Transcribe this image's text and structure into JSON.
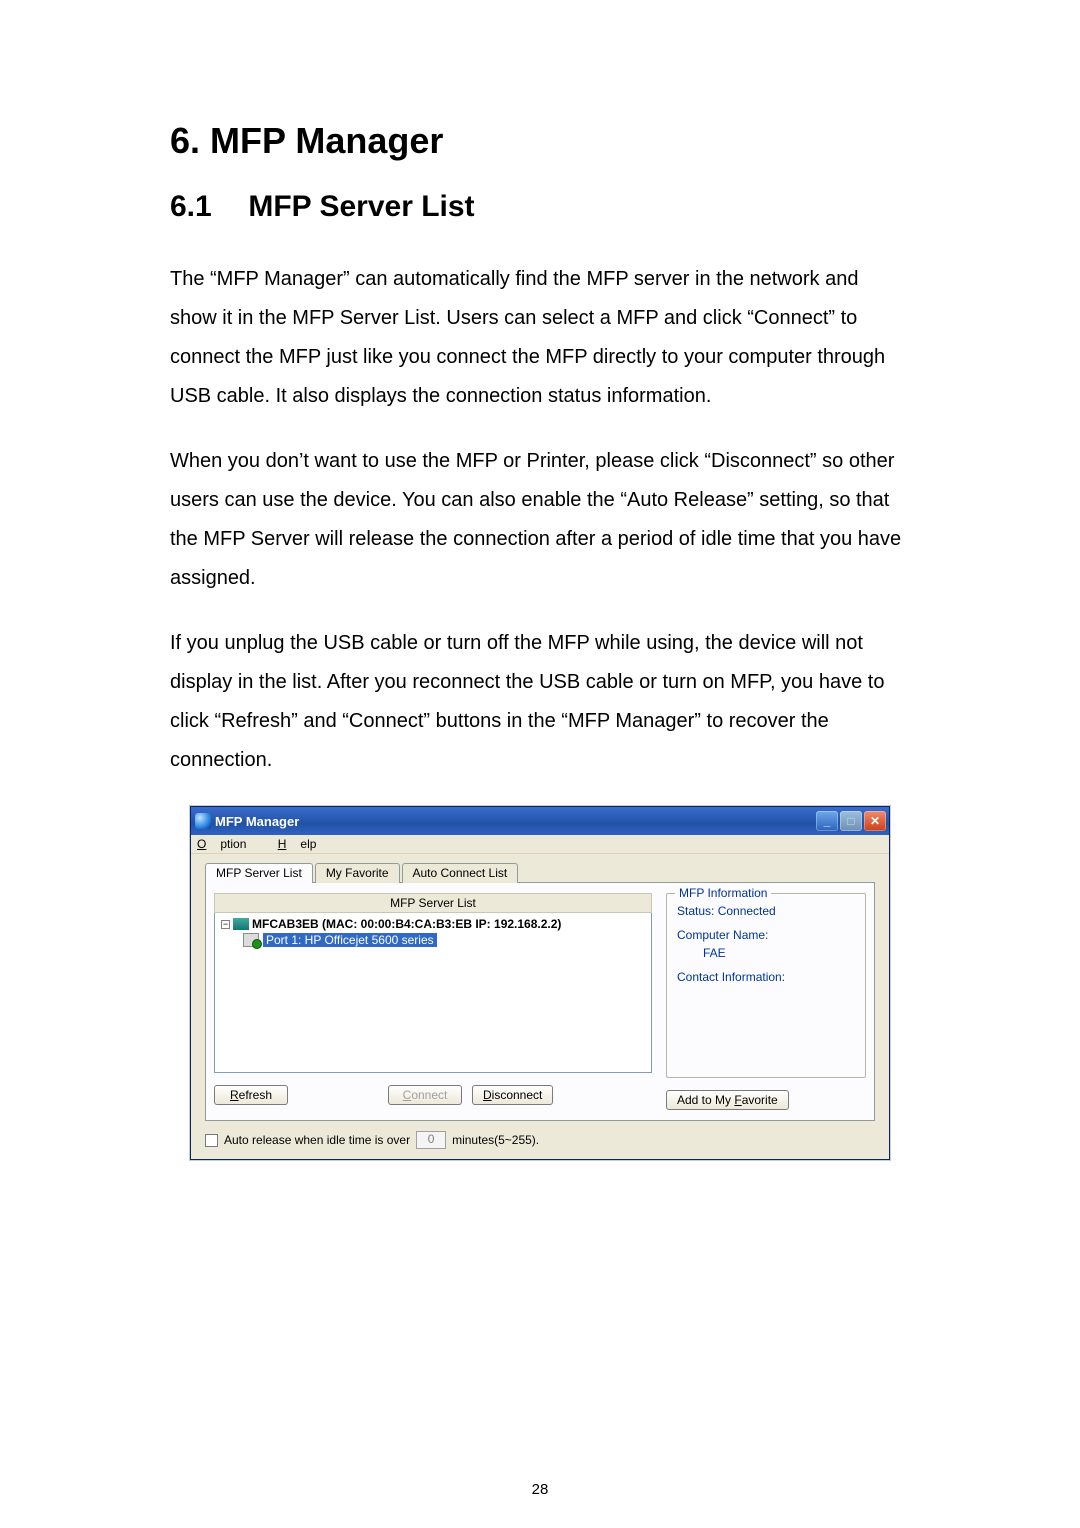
{
  "headings": {
    "h1": "6.  MFP Manager",
    "h2_num": "6.1",
    "h2_title": "MFP Server List"
  },
  "paras": {
    "p1": "The “MFP Manager” can automatically find the MFP server in the network and show it in the MFP Server List. Users can select a MFP and click “Connect” to connect the MFP just like you connect the MFP directly to your computer through USB cable. It also displays the connection status information.",
    "p2": "When you don’t want to use the MFP or Printer, please click “Disconnect” so other users can use the device. You can also enable the “Auto Release” setting, so that the MFP Server will release the connection after a period of idle time that you have assigned.",
    "p3": "If you unplug the USB cable or turn off the MFP while using, the device will not display in the list. After you reconnect the USB cable or turn on MFP, you have to click “Refresh” and “Connect” buttons in the “MFP Manager” to recover the connection."
  },
  "dialog": {
    "title": "MFP Manager",
    "menu": {
      "option": "Option",
      "help": "Help"
    },
    "tabs": {
      "t1": "MFP Server List",
      "t2": "My Favorite",
      "t3": "Auto Connect List"
    },
    "list_header": "MFP Server List",
    "tree": {
      "server": "MFCAB3EB (MAC: 00:00:B4:CA:B3:EB   IP: 192.168.2.2)",
      "port": "Port 1: HP Officejet 5600 series"
    },
    "info": {
      "legend": "MFP Information",
      "status": "Status: Connected",
      "cname_label": "Computer Name:",
      "cname_value": "FAE",
      "contact": "Contact Information:"
    },
    "buttons": {
      "refresh": "Refresh",
      "connect": "Connect",
      "disconnect": "Disconnect",
      "addfav": "Add to My Favorite"
    },
    "auto": {
      "label_before": "Auto release when idle time is over",
      "value": "0",
      "label_after": "minutes(5~255)."
    }
  },
  "page": "28"
}
